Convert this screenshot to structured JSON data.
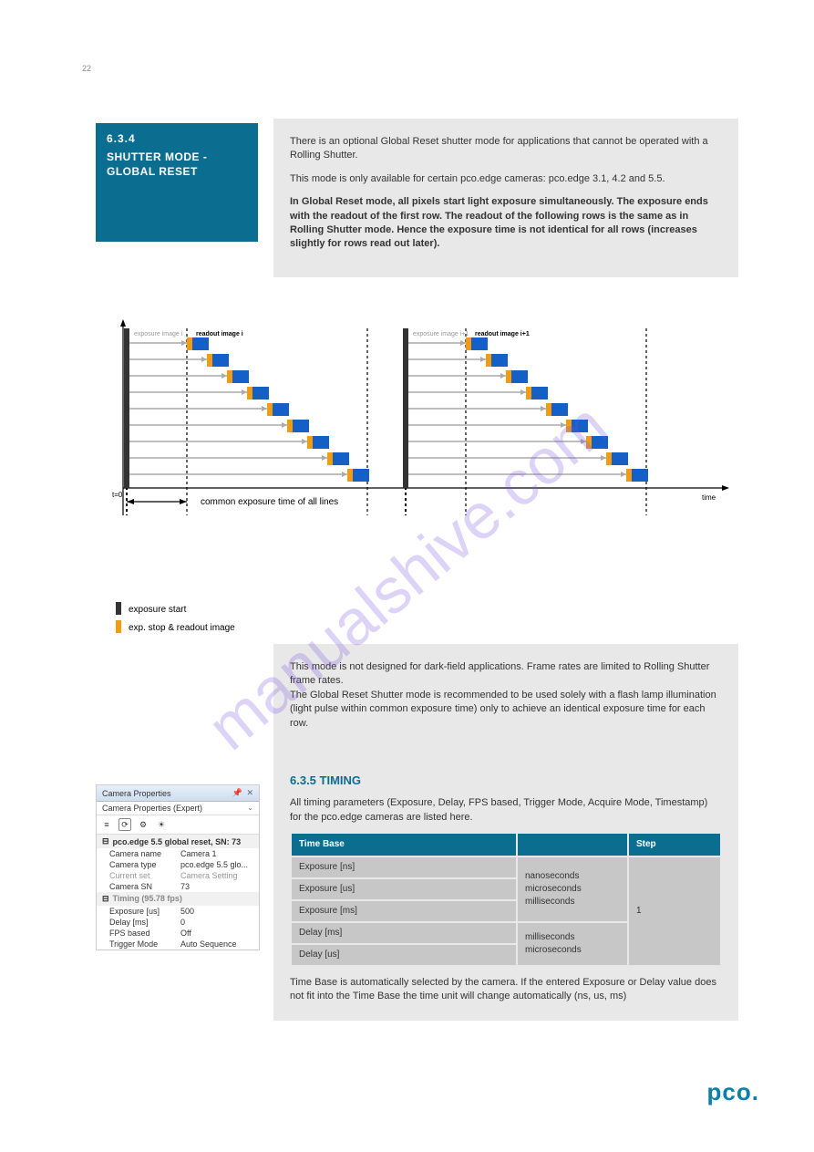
{
  "page_number": "22",
  "section": {
    "number": "6.3.4",
    "title": "SHUTTER MODE - GLOBAL RESET"
  },
  "body1": [
    "There is an optional Global Reset shutter mode for applications that cannot be operated with a Rolling Shutter.",
    "This mode is only available for certain pco.edge cameras: pco.edge 3.1, 4.2 and 5.5.",
    "In Global Reset mode, all pixels start light exposure simultaneously. The exposure ends with the readout of the first row. The readout of the following rows is the same as in Rolling Shutter mode. Hence the exposure time is not identical for all rows (increases slightly for rows read out later)."
  ],
  "diagram_labels": {
    "exposure_image_i": "exposure image i",
    "readout_image_i": "readout image i",
    "exposure_image_i1": "exposure image i+1",
    "readout_image_i1": "readout image i+1",
    "t0": "t=0",
    "time": "time",
    "common_exposure": "common exposure time of all lines",
    "legend1": "exposure start",
    "legend2": "exp. stop & readout image"
  },
  "body2": [
    "This mode is not designed for dark-field applications. Frame rates are limited to Rolling Shutter frame rates.",
    "The Global Reset Shutter mode is recommended to be used solely with a flash lamp illumination (light pulse within common exposure time) only to achieve an identical exposure time for each row."
  ],
  "subsection_title": "6.3.5 TIMING",
  "timing_text": "All timing parameters (Exposure, Delay, FPS based, Trigger Mode, Acquire Mode, Timestamp) for the pco.edge cameras are listed here.",
  "props": {
    "panel_title": "Camera Properties",
    "mode": "Camera Properties (Expert)",
    "group": "pco.edge 5.5 global reset, SN: 73",
    "rows": [
      {
        "k": "Camera name",
        "v": "Camera 1"
      },
      {
        "k": "Camera type",
        "v": "pco.edge 5.5 glo..."
      },
      {
        "k": "Current set",
        "v": "Camera Setting"
      },
      {
        "k": "Camera SN",
        "v": "73"
      }
    ],
    "timing_head": "Timing (95.78 fps)",
    "timing_rows": [
      {
        "k": "Exposure [us]",
        "v": "500"
      },
      {
        "k": "Delay [ms]",
        "v": "0"
      },
      {
        "k": "FPS based",
        "v": "Off"
      },
      {
        "k": "Trigger Mode",
        "v": "Auto Sequence"
      }
    ]
  },
  "timing_table": {
    "headers": [
      "Time Base",
      "",
      "Step"
    ],
    "rows": [
      [
        "Exposure [ns]",
        "nanoseconds",
        ""
      ],
      [
        "Exposure [us]",
        "microseconds",
        "1"
      ],
      [
        "Exposure [ms]",
        "milliseconds",
        ""
      ],
      [
        "Delay [ms]",
        "milliseconds",
        "1"
      ],
      [
        "Delay [us]",
        "microseconds",
        ""
      ]
    ]
  },
  "body3": "Time Base is automatically selected by the camera. If the entered Exposure or Delay value does not fit into the Time Base the time unit will change automatically (ns, us, ms)",
  "footer_logo": "pco.",
  "watermark": "manualshive.com"
}
